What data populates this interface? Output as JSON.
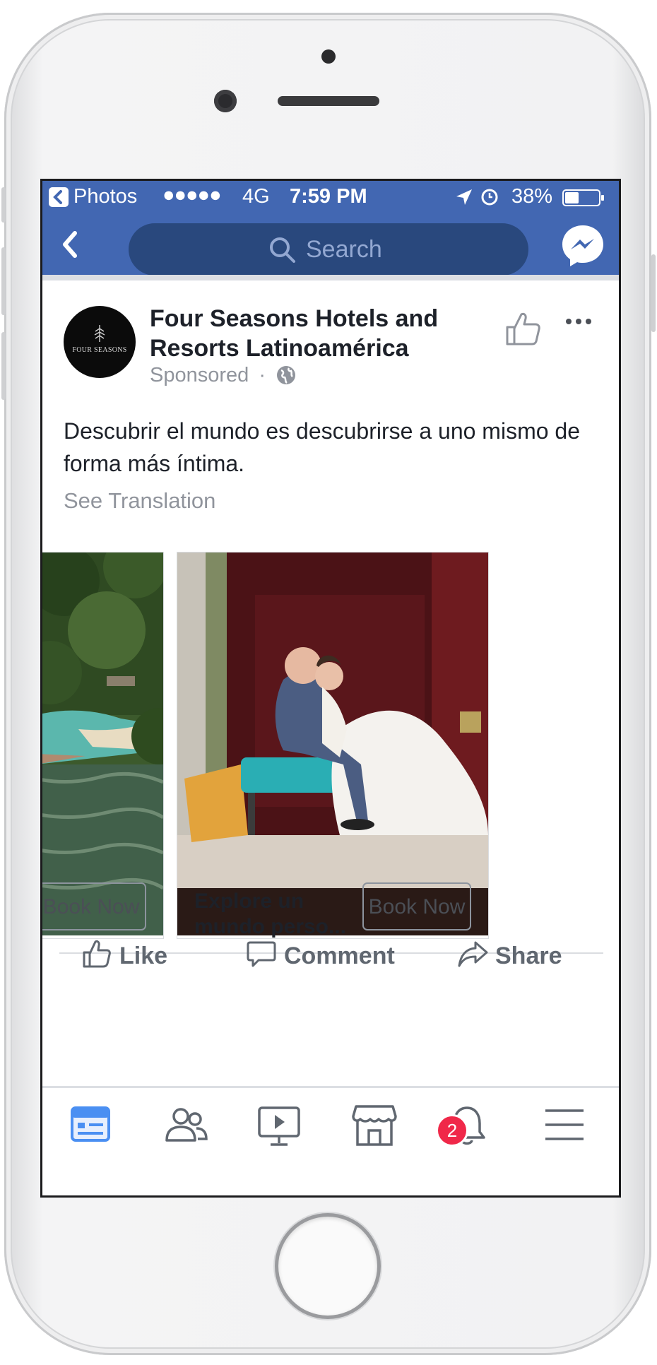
{
  "status_bar": {
    "back_app": "Photos",
    "signal": "●●●●●",
    "network": "4G",
    "time": "7:59 PM",
    "battery": "38%"
  },
  "nav": {
    "search_placeholder": "Search",
    "icons": [
      "back-icon",
      "search-icon",
      "messenger-icon"
    ]
  },
  "post": {
    "page_name": "Four Seasons Hotels and Resorts Latinoamérica",
    "avatar_text": "FOUR SEASONS",
    "sponsored": "Sponsored",
    "separator": "·",
    "body": "Descubrir el mundo es descubrirse a uno mismo de forma más íntima.",
    "see_translation": "See Translation",
    "carousel": [
      {
        "cta": "Book Now"
      },
      {
        "title": "Explore un mundo perso...",
        "cta": "Book Now"
      }
    ]
  },
  "actions": {
    "like": "Like",
    "comment": "Comment",
    "share": "Share"
  },
  "tabbar": {
    "tabs": [
      "news-feed-tab",
      "friends-tab",
      "watch-tab",
      "marketplace-tab",
      "notifications-tab",
      "menu-tab"
    ],
    "notifications_badge": "2"
  },
  "colors": {
    "facebook_blue": "#4267b2",
    "search_field": "#29487d",
    "badge_red": "#f02849"
  }
}
